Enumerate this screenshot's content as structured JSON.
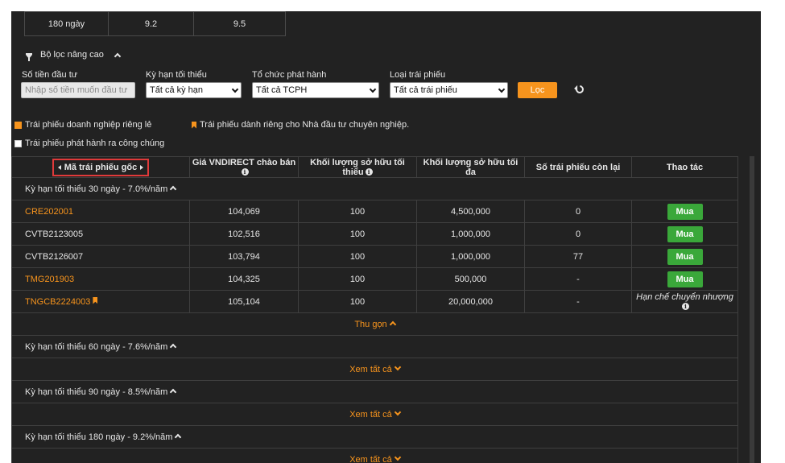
{
  "top_table": {
    "cells": [
      "180 ngày",
      "9.2",
      "9.5"
    ]
  },
  "filter": {
    "toggle_label": "Bộ lọc nâng cao",
    "amount_label": "Số tiền đầu tư",
    "amount_placeholder": "Nhập số tiền muốn đầu tư",
    "term_label": "Kỳ hạn tối thiểu",
    "term_value": "Tất cả kỳ hạn",
    "issuer_label": "Tổ chức phát hành",
    "issuer_value": "Tất cả TCPH",
    "type_label": "Loại trái phiếu",
    "type_value": "Tất cả trái phiếu",
    "submit_label": "Lọc"
  },
  "legend": {
    "private": "Trái phiếu doanh nghiệp riêng lẻ",
    "professional": "Trái phiếu dành riêng cho Nhà đầu tư chuyên nghiệp.",
    "public": "Trái phiếu phát hành ra công chúng"
  },
  "table": {
    "headers": [
      "Mã trái phiếu gốc",
      "Giá VNDIRECT chào bán",
      "Khối lượng sở hữu tối thiểu",
      "Khối lượng sở hữu tối đa",
      "Số trái phiếu còn lại",
      "Thao tác"
    ],
    "groups": [
      {
        "label": "Kỳ hạn tối thiểu 30 ngày - 7.0%/năm",
        "rows": [
          {
            "code": "CRE202001",
            "price": "104,069",
            "min": "100",
            "max": "4,500,000",
            "remaining": "0",
            "action": "Mua"
          },
          {
            "code": "CVTB2123005",
            "price": "102,516",
            "min": "100",
            "max": "1,000,000",
            "remaining": "0",
            "action": "Mua"
          },
          {
            "code": "CVTB2126007",
            "price": "103,794",
            "min": "100",
            "max": "1,000,000",
            "remaining": "77",
            "action": "Mua"
          },
          {
            "code": "TMG201903",
            "price": "104,325",
            "min": "100",
            "max": "500,000",
            "remaining": "-",
            "action": "Mua"
          },
          {
            "code": "TNGCB2224003",
            "price": "105,104",
            "min": "100",
            "max": "20,000,000",
            "remaining": "-",
            "action": "Hạn chế chuyển nhượng"
          }
        ],
        "footer": "Thu gọn"
      },
      {
        "label": "Kỳ hạn tối thiểu 60 ngày - 7.6%/năm",
        "footer": "Xem tất cả"
      },
      {
        "label": "Kỳ hạn tối thiểu 90 ngày - 8.5%/năm",
        "footer": "Xem tất cả"
      },
      {
        "label": "Kỳ hạn tối thiểu 180 ngày - 9.2%/năm",
        "footer": "Xem tất cả"
      }
    ]
  },
  "colors": {
    "accent": "#f7941d",
    "buy": "#3aa83a",
    "panel": "#222222",
    "highlight": "#e03a3a"
  }
}
